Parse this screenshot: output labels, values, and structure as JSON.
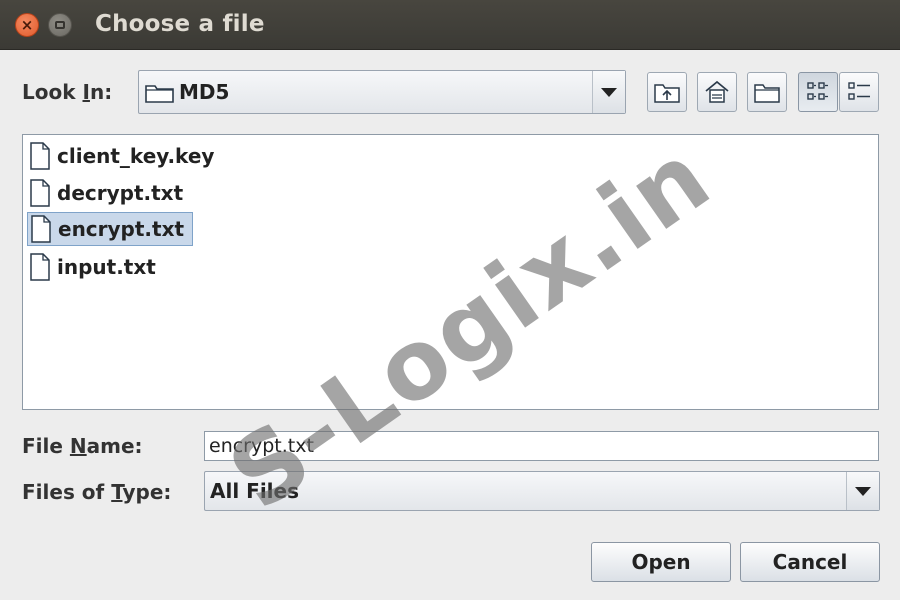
{
  "window": {
    "title": "Choose a file"
  },
  "look_in": {
    "label_prefix": "Look ",
    "label_mnemonic": "I",
    "label_suffix": "n:",
    "value": "MD5"
  },
  "toolbar": {
    "icons": [
      "up-one-level-icon",
      "home-icon",
      "new-folder-icon",
      "list-view-icon",
      "details-view-icon"
    ],
    "active_view": "list-view"
  },
  "files": [
    {
      "name": "client_key.key",
      "selected": false
    },
    {
      "name": "decrypt.txt",
      "selected": false
    },
    {
      "name": "encrypt.txt",
      "selected": true
    },
    {
      "name": "input.txt",
      "selected": false
    }
  ],
  "file_name": {
    "label_prefix": "File ",
    "label_mnemonic": "N",
    "label_suffix": "ame:",
    "value": "encrypt.txt"
  },
  "files_of_type": {
    "label_prefix": "Files of ",
    "label_mnemonic": "T",
    "label_suffix": "ype:",
    "value": "All Files"
  },
  "buttons": {
    "open": "Open",
    "cancel": "Cancel"
  },
  "watermark": "S-Logix.in"
}
